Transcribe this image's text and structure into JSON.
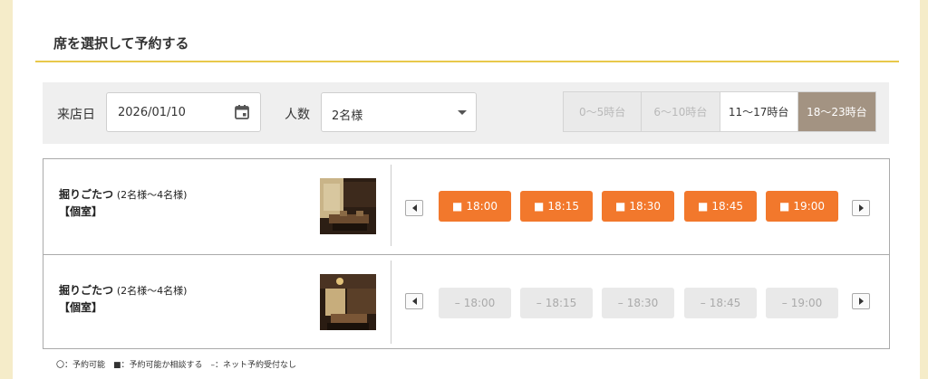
{
  "section": {
    "title": "席を選択して予約する"
  },
  "filter": {
    "date_label": "来店日",
    "date_value": "2026/01/10",
    "party_label": "人数",
    "party_value": "2名様",
    "time_tabs": [
      {
        "label": "0〜5時台",
        "state": "disabled"
      },
      {
        "label": "6〜10時台",
        "state": "disabled"
      },
      {
        "label": "11〜17時台",
        "state": "enabled"
      },
      {
        "label": "18〜23時台",
        "state": "active"
      }
    ]
  },
  "seats": [
    {
      "name": "掘りごたつ",
      "capacity": "(2名様〜4名様)",
      "type": "【個室】",
      "slots": [
        {
          "mark": "■",
          "time": "18:00",
          "status": "available"
        },
        {
          "mark": "■",
          "time": "18:15",
          "status": "available"
        },
        {
          "mark": "■",
          "time": "18:30",
          "status": "available"
        },
        {
          "mark": "■",
          "time": "18:45",
          "status": "available"
        },
        {
          "mark": "■",
          "time": "19:00",
          "status": "available"
        }
      ]
    },
    {
      "name": "掘りごたつ",
      "capacity": "(2名様〜4名様)",
      "type": "【個室】",
      "slots": [
        {
          "mark": "–",
          "time": "18:00",
          "status": "unavailable"
        },
        {
          "mark": "–",
          "time": "18:15",
          "status": "unavailable"
        },
        {
          "mark": "–",
          "time": "18:30",
          "status": "unavailable"
        },
        {
          "mark": "–",
          "time": "18:45",
          "status": "unavailable"
        },
        {
          "mark": "–",
          "time": "19:00",
          "status": "unavailable"
        }
      ]
    }
  ],
  "legend": "〇：予約可能　■：予約可能か相談する　–：ネット予約受付なし",
  "icons": {
    "calendar": "calendar-icon",
    "dropdown": "chevron-down-icon",
    "prev": "arrow-left-icon",
    "next": "arrow-right-icon"
  },
  "colors": {
    "accent": "#f2782c",
    "active_tab": "#a39382",
    "rule": "#e8c84a",
    "background": "#f5ecc9"
  }
}
